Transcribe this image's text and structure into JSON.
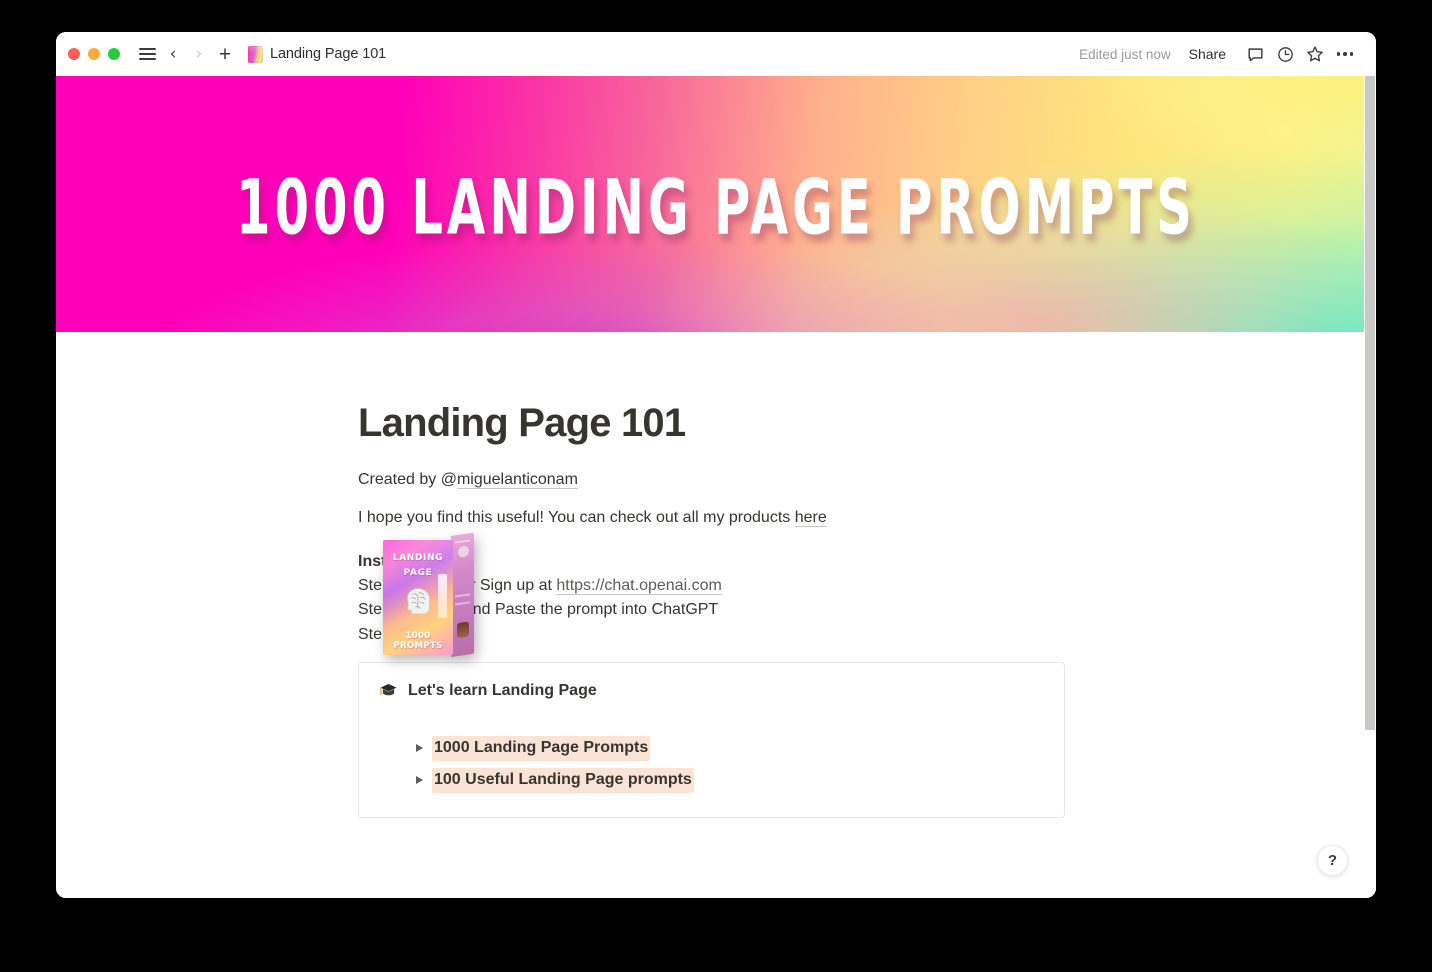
{
  "window": {
    "titlebar": {
      "traffic_lights": [
        {
          "name": "close",
          "color": "#ff5f57"
        },
        {
          "name": "minimize",
          "color": "#f5ad3f"
        },
        {
          "name": "maximize",
          "color": "#28c840"
        }
      ],
      "sidebar_toggle_icon": "hamburger-menu-icon",
      "back_icon": "chevron-left-icon",
      "forward_icon": "chevron-right-icon",
      "new_page_icon": "plus-icon",
      "tab_icon": "page-thumbnail-icon",
      "tab_title": "Landing Page 101",
      "edited_label": "Edited just now",
      "share_label": "Share",
      "comment_icon": "comment-bubble-icon",
      "history_icon": "clock-history-icon",
      "favorite_icon": "star-icon",
      "more_icon": "more-horizontal-icon"
    }
  },
  "cover": {
    "title": "1000 LANDING PAGE PROMPTS",
    "gradient_colors": [
      "#ff00b8",
      "#f8679b",
      "#ffaf8c",
      "#ffe47c",
      "#46f0c8",
      "#c43cd2"
    ]
  },
  "page_icon": {
    "name": "landing-page-prompts-box-icon",
    "line1": "LANDING",
    "line2": "PAGE",
    "line3": "1000 PROMPTS",
    "illustration": "brain-head-icon"
  },
  "document": {
    "title": "Landing Page 101",
    "created_by_prefix": "Created by @",
    "created_by_handle": "miguelanticonam",
    "intro_text": "I hope you find this useful! You can check out all my products ",
    "intro_link": "here",
    "instructions_heading": "Instructions:",
    "step1_prefix": "Step 1: Log in or Sign up at ",
    "step1_link": "https://chat.openai.com",
    "step2": "Step 2: Unfold and Paste the prompt into ChatGPT",
    "step3": "Step 3: Enjoy!"
  },
  "callout": {
    "icon": "graduation-cap-emoji",
    "title": "Let's learn Landing Page",
    "toggles": [
      {
        "label": "1000 Landing Page Prompts",
        "expanded": false,
        "highlight_color": "#fbe4d5"
      },
      {
        "label": "100 Useful Landing Page prompts",
        "expanded": false,
        "highlight_color": "#fbe4d5"
      }
    ]
  },
  "help_button": {
    "label": "?",
    "name": "help-button"
  },
  "scrollbar": {
    "thumb_color": "#c9c9c7"
  }
}
